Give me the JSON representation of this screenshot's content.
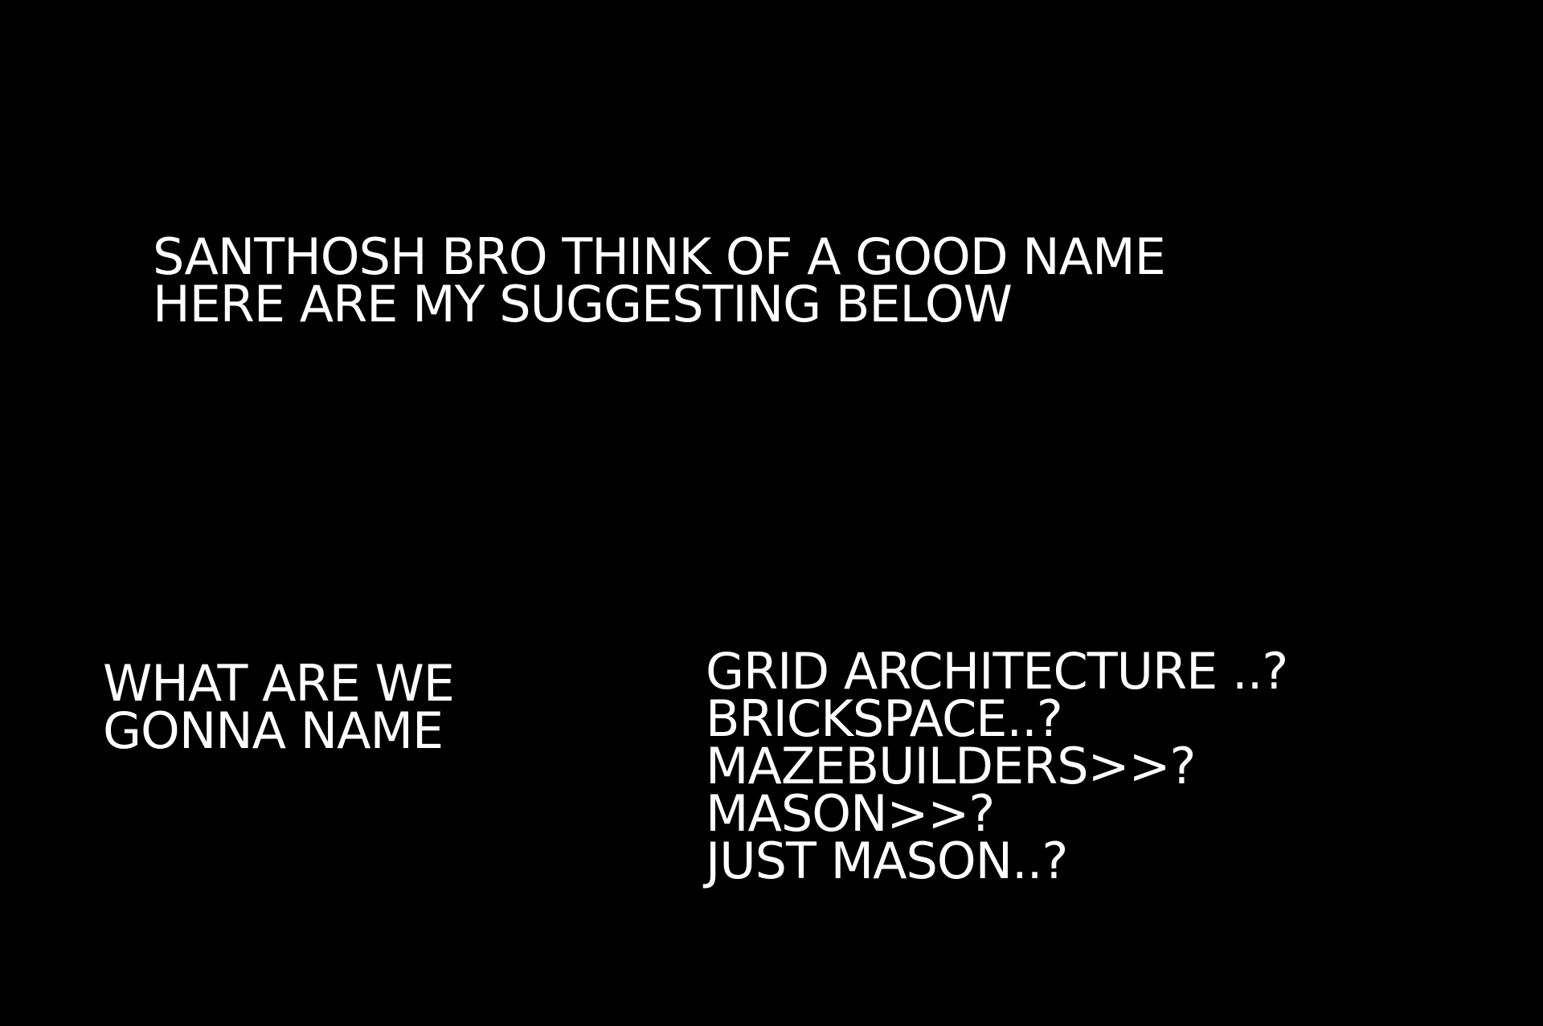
{
  "background_color": "#000000",
  "text_color": "#ffffff",
  "heading": {
    "line1": "SANTHOSH BRO THINK OF A GOOD NAME",
    "line2": "HERE ARE MY SUGGESTING BELOW"
  },
  "question": {
    "line1": "WHAT ARE WE",
    "line2": "GONNA NAME"
  },
  "suggestions": [
    "GRID ARCHITECTURE ..?",
    "BRICKSPACE..?",
    "MAZEBUILDERS>>?",
    "MASON>>?",
    "JUST MASON..?"
  ]
}
